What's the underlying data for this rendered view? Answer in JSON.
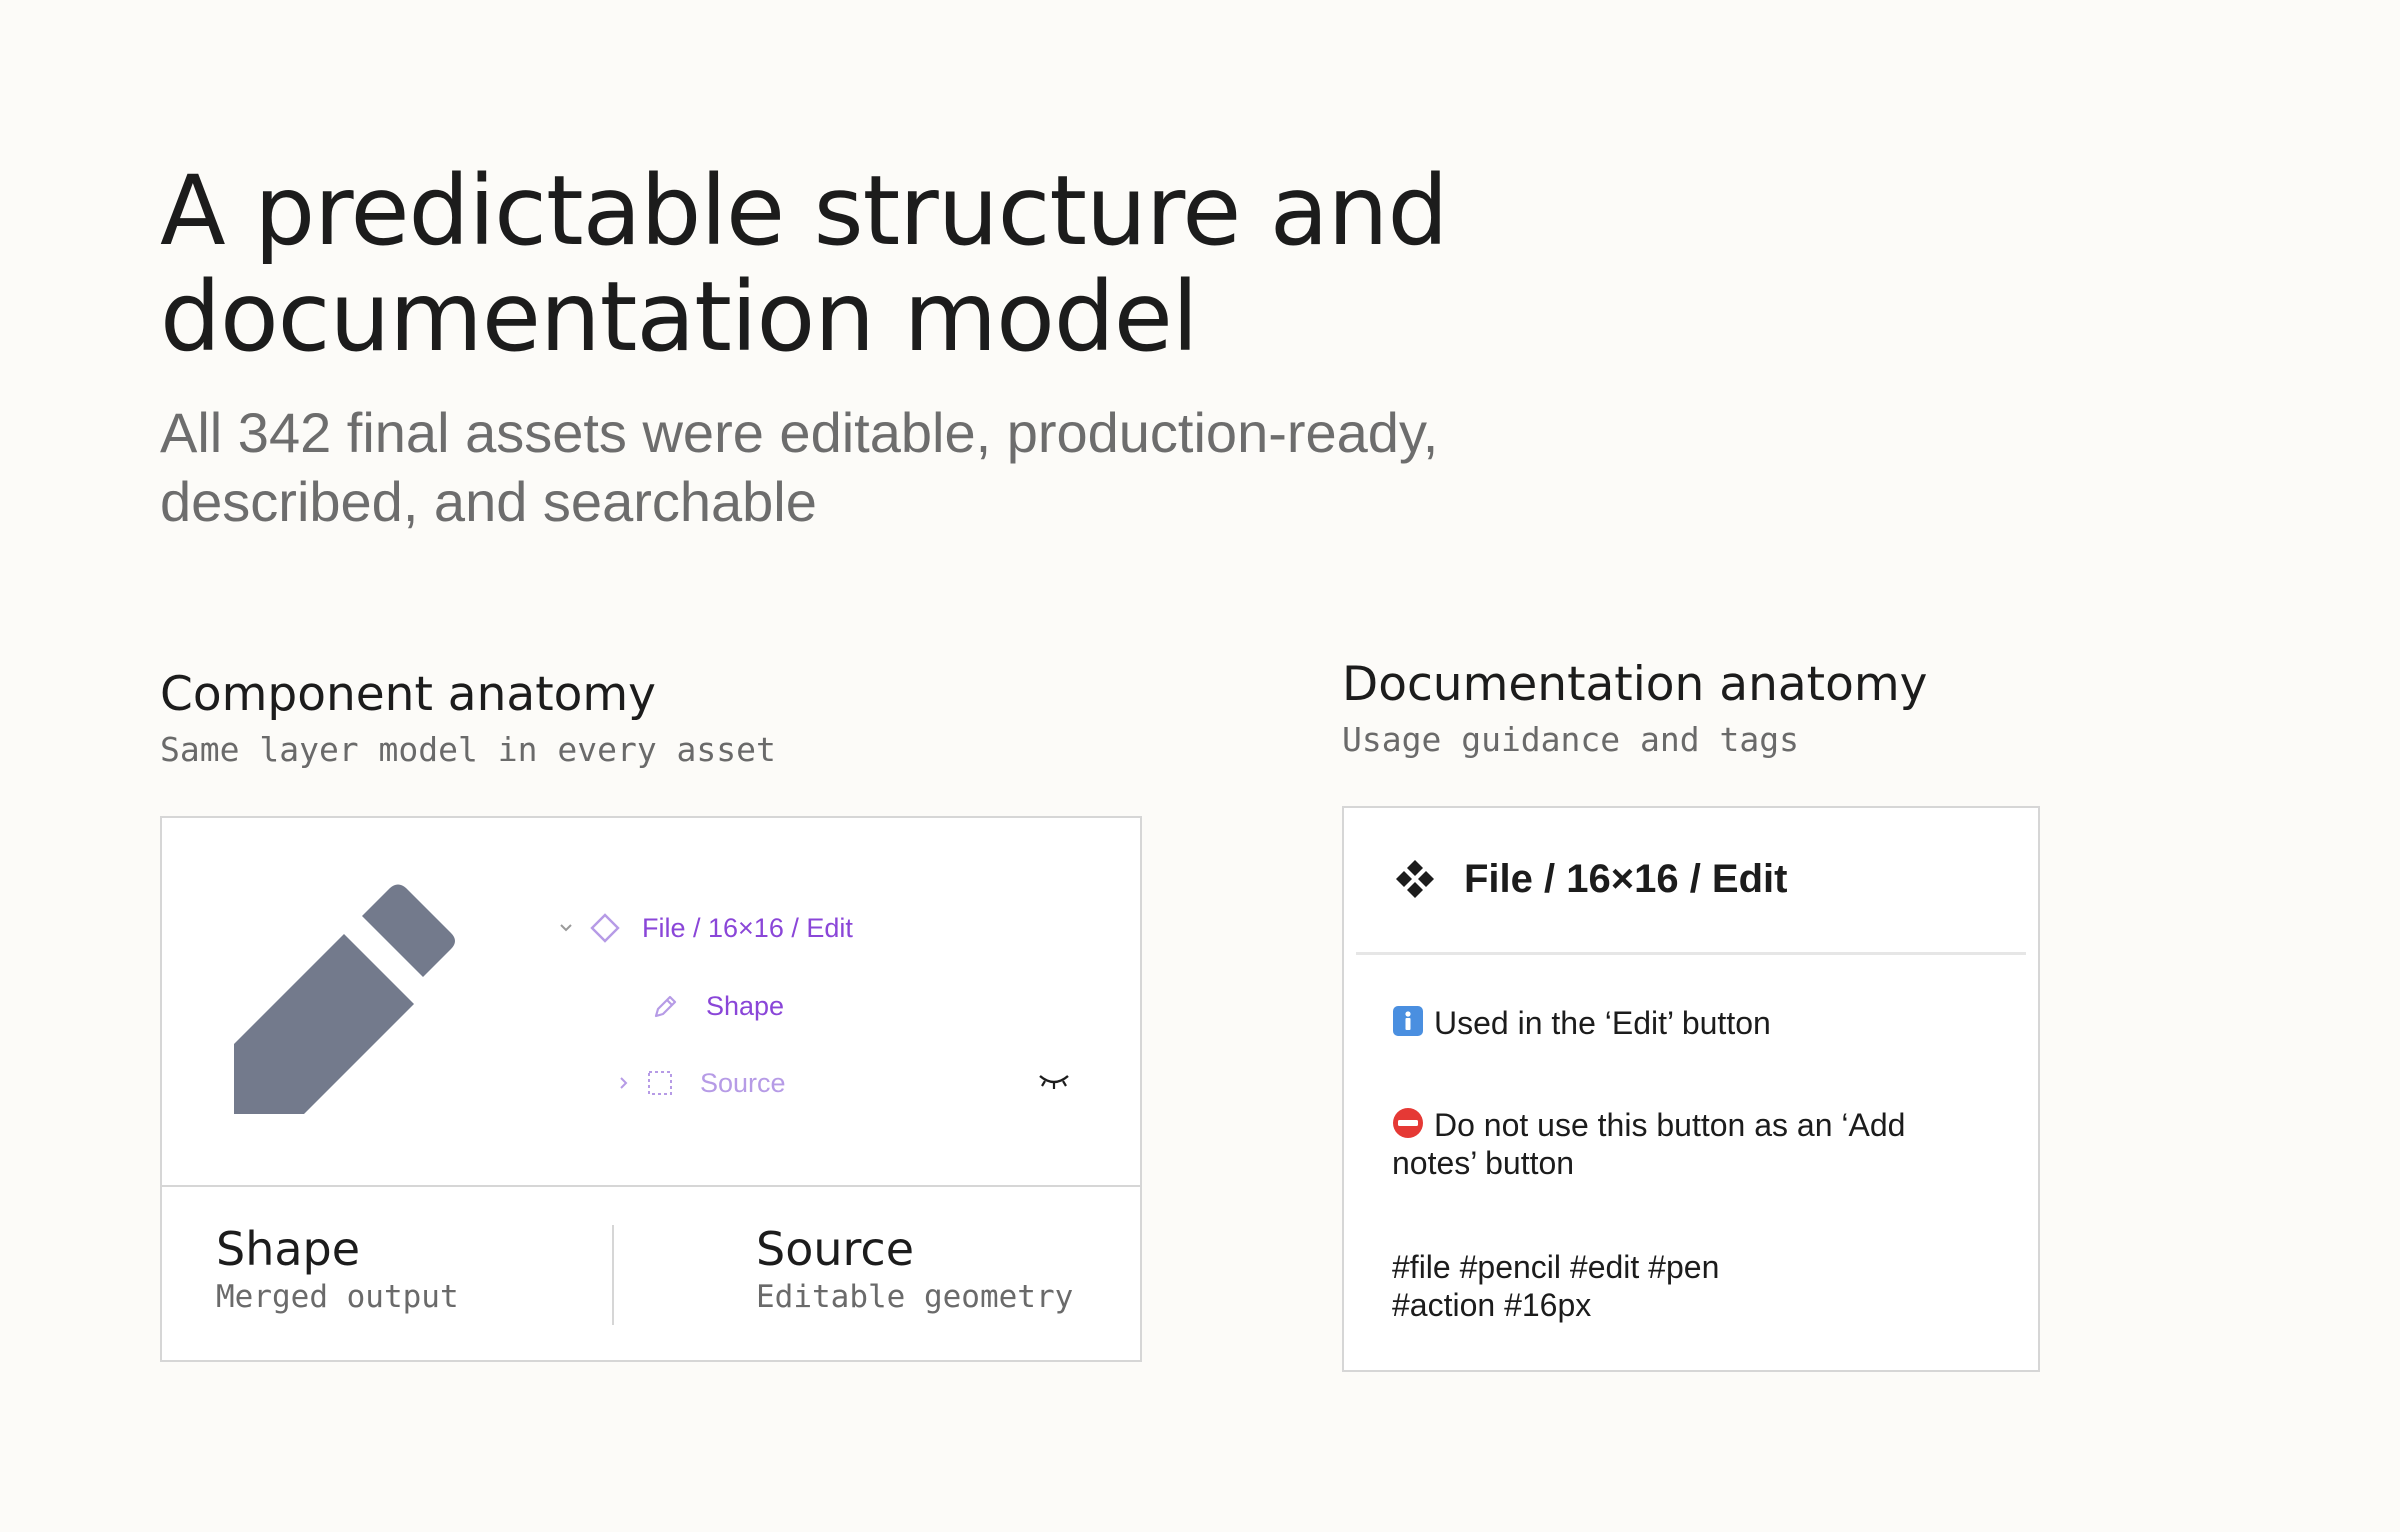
{
  "header": {
    "title": "A predictable structure and documentation model",
    "subtitle": "All 342 final assets were editable, production-ready, described, and searchable"
  },
  "component_section": {
    "title": "Component anatomy",
    "subtitle": "Same layer model in every asset",
    "layers": {
      "file_label": "File / 16×16 / Edit",
      "shape_label": "Shape",
      "source_label": "Source"
    },
    "legend": {
      "shape_title": "Shape",
      "shape_desc": "Merged output",
      "source_title": "Source",
      "source_desc": "Editable geometry"
    }
  },
  "documentation_section": {
    "title": "Documentation anatomy",
    "subtitle": "Usage guidance and tags",
    "card": {
      "component_name": "File / 16×16 / Edit",
      "usage": "Used in the ‘Edit’ button",
      "warning": "Do not use this button as an ‘Add notes’ button",
      "tags": "#file #pencil #edit #pen #action #16px"
    }
  },
  "colors": {
    "background": "#fcfbf8",
    "pencil": "#737a8c",
    "layer_accent": "#8a46d8",
    "layer_muted": "#b69be6",
    "info_badge": "#4a8fe0",
    "warning_badge": "#e53935"
  },
  "icons": [
    "pencil-icon",
    "chevron-down-icon",
    "diamond-component-icon",
    "pen-icon",
    "chevron-right-icon",
    "dashed-frame-icon",
    "eye-closed-icon",
    "component-icon",
    "info-icon",
    "no-entry-icon"
  ]
}
